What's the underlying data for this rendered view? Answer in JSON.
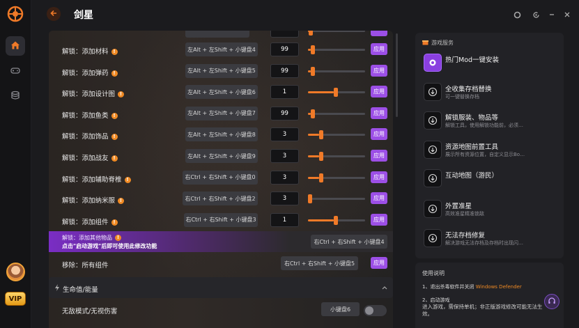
{
  "app": {
    "title": "剑星"
  },
  "sidebar": {
    "items": [
      {
        "name": "home-icon",
        "active": true
      },
      {
        "name": "gamepad-icon",
        "active": false
      },
      {
        "name": "database-icon",
        "active": false
      }
    ],
    "vip_label": "VIP"
  },
  "cheats": {
    "apply_label": "应用",
    "rows": [
      {
        "label": "解锁：添加材料",
        "hotkey": "左Alt + 左Shift + 小键盘4",
        "value": "99",
        "slider": 0.05
      },
      {
        "label": "解锁：添加弹药",
        "hotkey": "左Alt + 左Shift + 小键盘5",
        "value": "99",
        "slider": 0.05
      },
      {
        "label": "解锁：添加设计图",
        "hotkey": "左Alt + 左Shift + 小键盘6",
        "value": "1",
        "slider": 0.45
      },
      {
        "label": "解锁：添加鱼类",
        "hotkey": "左Alt + 左Shift + 小键盘7",
        "value": "99",
        "slider": 0.05
      },
      {
        "label": "解锁：添加饰品",
        "hotkey": "左Alt + 左Shift + 小键盘8",
        "value": "3",
        "slider": 0.2
      },
      {
        "label": "解锁：添加战友",
        "hotkey": "左Alt + 左Shift + 小键盘9",
        "value": "3",
        "slider": 0.2
      },
      {
        "label": "解锁：添加辅助脊椎",
        "hotkey": "右Ctrl + 右Shift + 小键盘0",
        "value": "3",
        "slider": 0.2
      },
      {
        "label": "解锁：添加纳米服",
        "hotkey": "右Ctrl + 右Shift + 小键盘2",
        "value": "3",
        "slider": 0.0
      },
      {
        "label": "解锁：添加组件",
        "hotkey": "右Ctrl + 右Shift + 小键盘3",
        "value": "1",
        "slider": 0.45
      }
    ],
    "promo": {
      "line1": "解锁：添加其他物品",
      "line2": "点击\"启动游戏\"后即可使用此修改功能",
      "hotkey": "右Ctrl + 右Shift + 小键盘4"
    },
    "remove_row": {
      "label": "移除：所有组件",
      "hotkey": "右Ctrl + 右Shift + 小键盘5"
    },
    "section": {
      "title": "生命值/能量"
    },
    "god_row": {
      "label": "无敌模式/无视伤害",
      "hotkey": "小键盘6",
      "enabled": false
    }
  },
  "services": {
    "header": "游戏服务",
    "items": [
      {
        "icon": "mod-icon",
        "title": "热门Mod一键安装",
        "subtitle": ""
      },
      {
        "icon": "download-icon",
        "title": "全收集存档替换",
        "subtitle": "可一键替换存档"
      },
      {
        "icon": "download-icon",
        "title": "解锁服装、物品等",
        "subtitle": "解锁工具，使用解锁功能前，必须…"
      },
      {
        "icon": "download-icon",
        "title": "资源地图前置工具",
        "subtitle": "展示所有资源位置，自定义显示Bo…"
      },
      {
        "icon": "download-icon",
        "title": "互动地图（游民）",
        "subtitle": ""
      },
      {
        "icon": "download-icon",
        "title": "外置准星",
        "subtitle": "高效准星精准锁敌"
      },
      {
        "icon": "download-icon",
        "title": "无法存档修复",
        "subtitle": "解决游戏无法存档及存档时出现闪…"
      }
    ]
  },
  "notes": {
    "title": "使用说明",
    "step1_prefix": "1、退出杀毒软件并关闭",
    "step1_highlight": "Windows Defender",
    "step2_title": "2、启动游戏",
    "step2_body": "进入游戏，需保持单机；非正版游戏修改可能无法生效。"
  },
  "colors": {
    "accent": "#f07a28",
    "apply": "#9c4fe6",
    "promo": "#7a2dc4"
  }
}
